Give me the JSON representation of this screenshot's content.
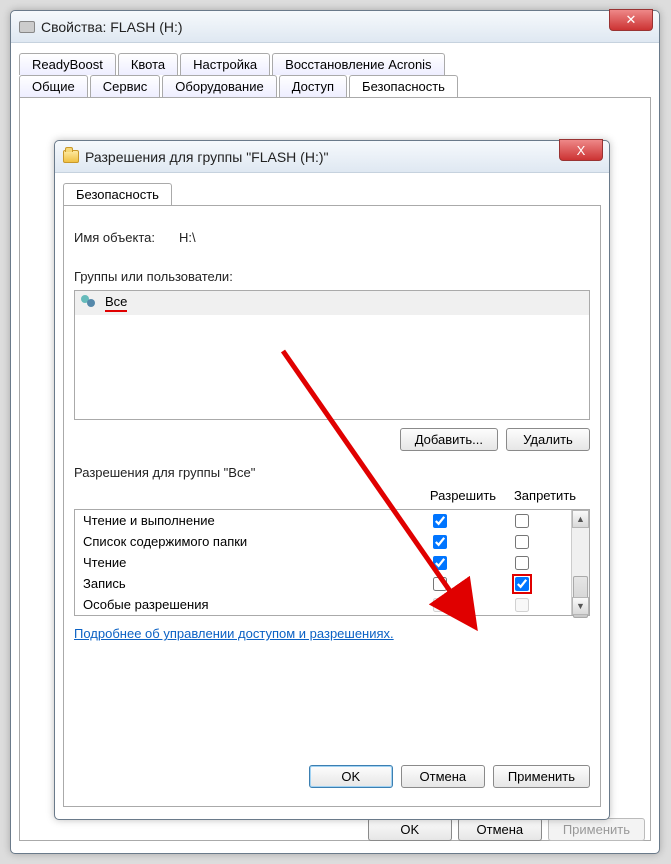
{
  "props": {
    "title": "Свойства: FLASH (H:)",
    "tabs_row1": [
      "ReadyBoost",
      "Квота",
      "Настройка",
      "Восстановление Acronis"
    ],
    "tabs_row2": [
      "Общие",
      "Сервис",
      "Оборудование",
      "Доступ",
      "Безопасность"
    ],
    "active_tab": "Безопасность",
    "buttons": {
      "ok": "OK",
      "cancel": "Отмена",
      "apply": "Применить"
    }
  },
  "perm": {
    "title": "Разрешения для группы \"FLASH (H:)\"",
    "tab": "Безопасность",
    "object_label": "Имя объекта:",
    "object_value": "H:\\",
    "groups_label": "Группы или пользователи:",
    "group_item": "Все",
    "add": "Добавить...",
    "remove": "Удалить",
    "perms_for": "Разрешения для группы \"Все\"",
    "col_allow": "Разрешить",
    "col_deny": "Запретить",
    "rows": [
      {
        "name": "Чтение и выполнение",
        "allow": true,
        "deny": false
      },
      {
        "name": "Список содержимого папки",
        "allow": true,
        "deny": false
      },
      {
        "name": "Чтение",
        "allow": true,
        "deny": false
      },
      {
        "name": "Запись",
        "allow": false,
        "deny": true
      },
      {
        "name": "Особые разрешения",
        "allow": false,
        "deny": false
      }
    ],
    "link": "Подробнее об управлении доступом и разрешениях.",
    "buttons": {
      "ok": "OK",
      "cancel": "Отмена",
      "apply": "Применить"
    },
    "close_x": "X"
  }
}
